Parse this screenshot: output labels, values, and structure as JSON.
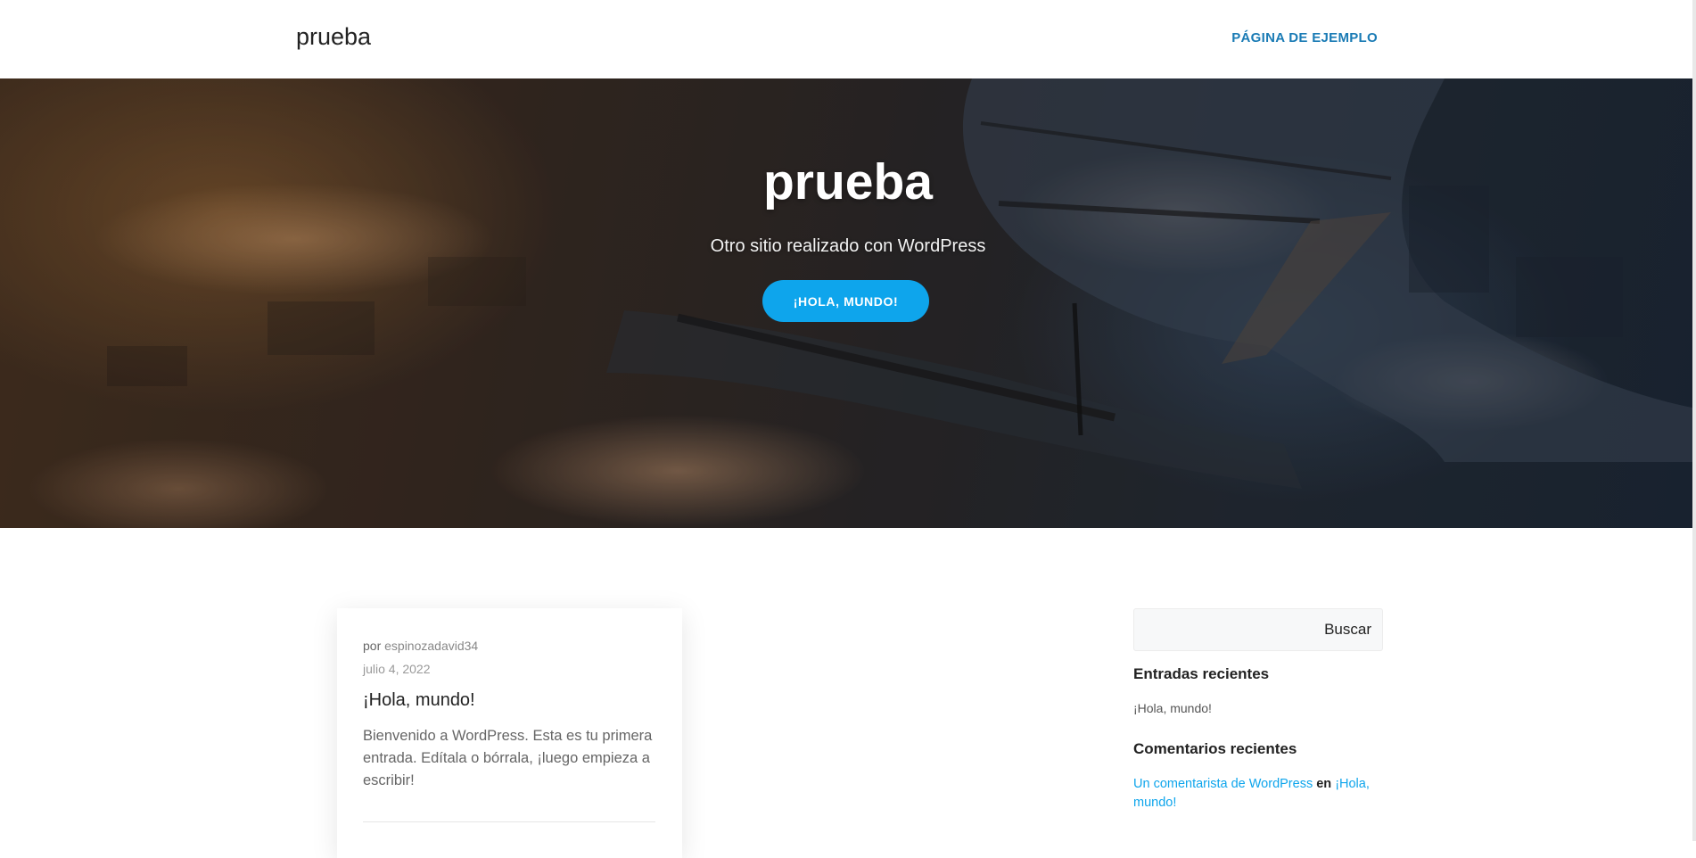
{
  "header": {
    "site_title": "prueba",
    "nav_items": [
      {
        "label": "PÁGINA DE EJEMPLO"
      }
    ]
  },
  "hero": {
    "title": "prueba",
    "tagline": "Otro sitio realizado con WordPress",
    "button_label": "¡HOLA, MUNDO!"
  },
  "post": {
    "author_prefix": "por",
    "author": "espinozadavid34",
    "date": "julio 4, 2022",
    "title": "¡Hola, mundo!",
    "excerpt": "Bienvenido a WordPress. Esta es tu primera entrada. Edítala o bórrala, ¡luego empieza a escribir!"
  },
  "sidebar": {
    "search": {
      "placeholder": "",
      "button_label": "Buscar"
    },
    "recent_posts": {
      "title": "Entradas recientes",
      "items": [
        "¡Hola, mundo!"
      ]
    },
    "recent_comments": {
      "title": "Comentarios recientes",
      "items": [
        {
          "author": "Un comentarista de WordPress",
          "connector": "en",
          "post": "¡Hola, mundo!"
        }
      ]
    }
  },
  "colors": {
    "accent": "#0ea5ec",
    "nav_link": "#1a7bb5"
  }
}
